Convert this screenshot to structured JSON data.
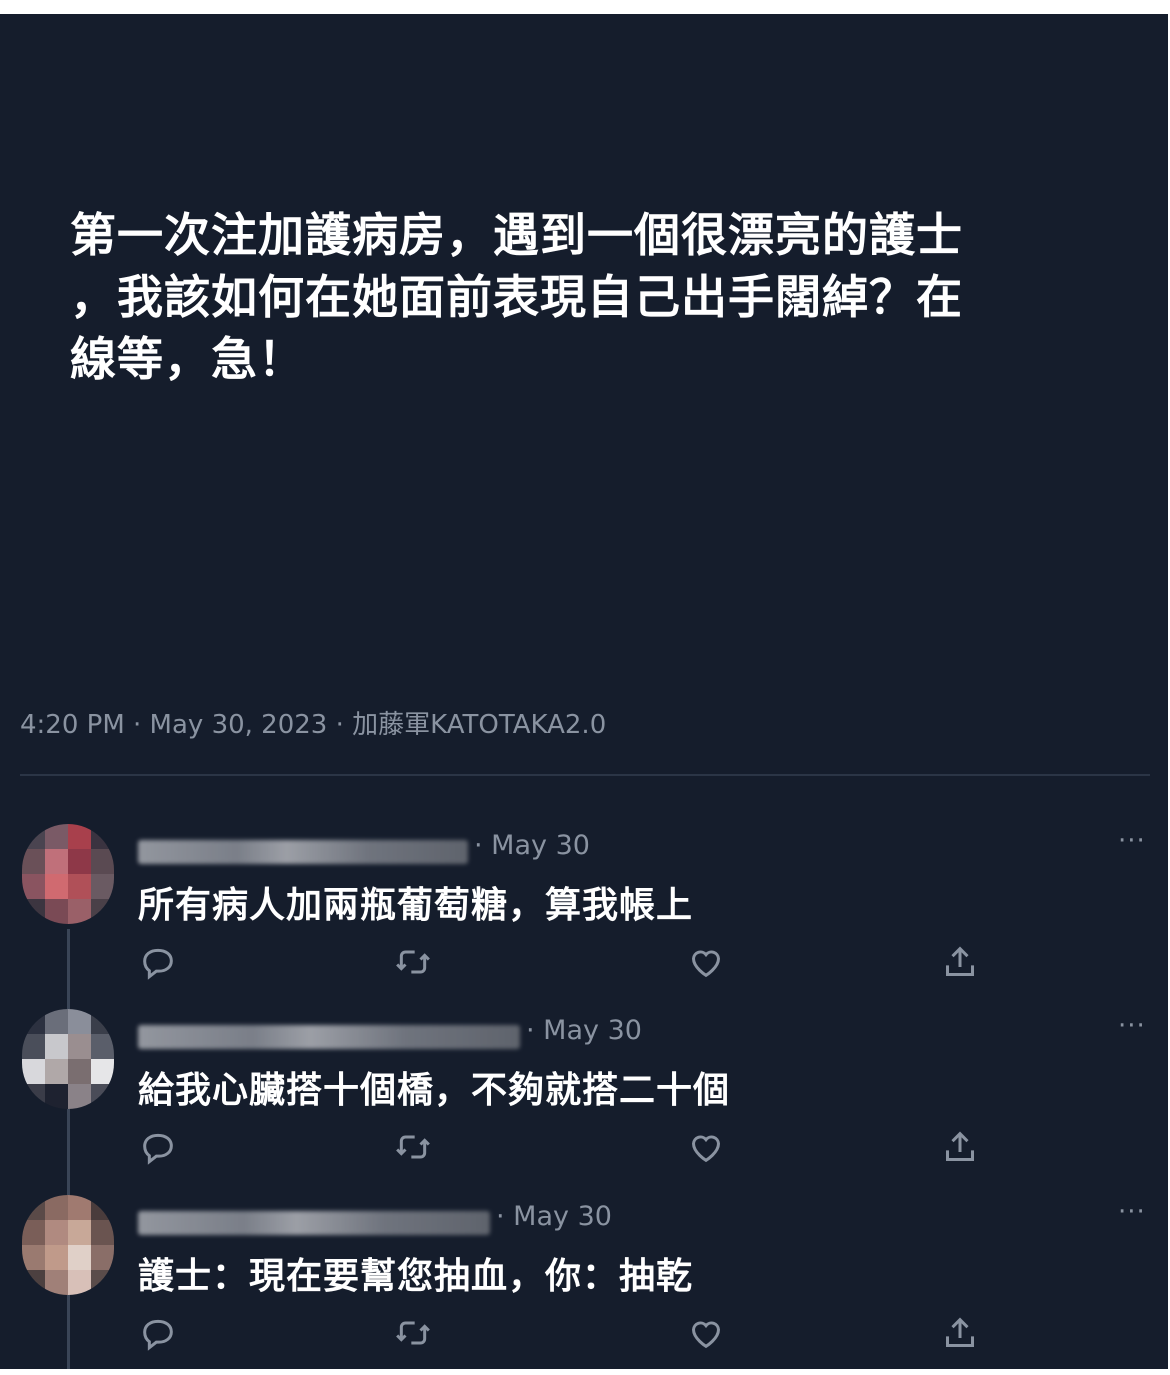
{
  "post": {
    "text": "第一次注加護病房，遇到一個很漂亮的護士\n，我該如何在她面前表現自己出手闊綽？在\n線等，急！",
    "meta": "4:20 PM · May 30, 2023 · 加藤軍KATOTAKA2.0"
  },
  "replies": [
    {
      "date": "· May 30",
      "text": "所有病人加兩瓶葡萄糖，算我帳上",
      "more": "···",
      "avatar_colors": [
        "#4a4450",
        "#7a5a66",
        "#a8404c",
        "#3a3340",
        "#6a5058",
        "#c0707a",
        "#8e3848",
        "#5a4a52",
        "#8a5460",
        "#d06a70",
        "#b05058",
        "#6a5a62",
        "#3c3540",
        "#7a4a55",
        "#9a6068",
        "#4a4048"
      ]
    },
    {
      "date": "· May 30",
      "text": "給我心臟搭十個橋，不夠就搭二十個",
      "more": "···",
      "avatar_colors": [
        "#2c3140",
        "#6a6e7a",
        "#8a8e9a",
        "#3a3e4a",
        "#4a4e5a",
        "#c8c8cc",
        "#9a8e90",
        "#5a5e6a",
        "#d8d8dc",
        "#b0a8a8",
        "#7a6e70",
        "#e6e6e8",
        "#3a3c48",
        "#1e2230",
        "#8a8288",
        "#4a4c58"
      ]
    },
    {
      "date": "· May 30",
      "text": "護士：現在要幫您抽血，你：抽乾",
      "more": "···",
      "avatar_colors": [
        "#5a4a48",
        "#8a6a62",
        "#a07a70",
        "#4a3c3c",
        "#7a5e58",
        "#b08a80",
        "#c8a898",
        "#6a5450",
        "#9a7a70",
        "#c09a8a",
        "#e0d0c8",
        "#8a6e68",
        "#4c4040",
        "#a08078",
        "#d8c0b8",
        "#5a4c4a"
      ]
    }
  ],
  "icons": {
    "reply": "reply-icon",
    "retweet": "retweet-icon",
    "like": "like-icon",
    "share": "share-icon"
  },
  "colors": {
    "background": "#151d2c",
    "text": "#ffffff",
    "muted": "#8a93a1"
  }
}
